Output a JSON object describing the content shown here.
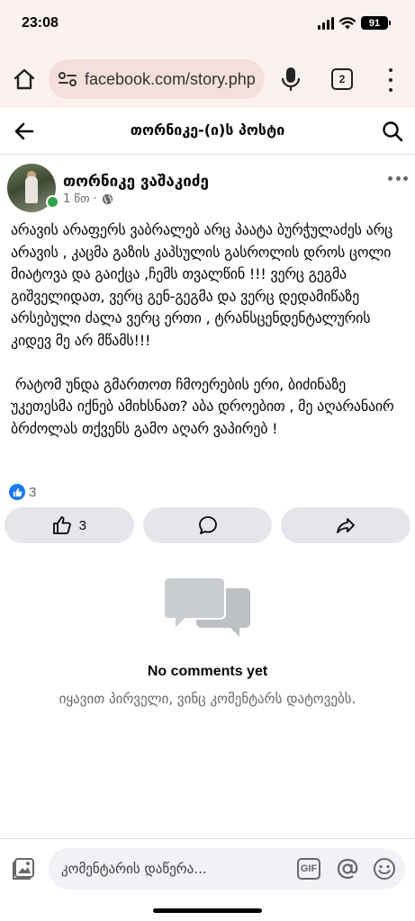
{
  "status_bar": {
    "time": "23:08",
    "battery": "91"
  },
  "browser": {
    "url": "facebook.com/story.php",
    "tab_count": "2"
  },
  "header": {
    "title": "თორნიკე-(ი)ს პოსტი"
  },
  "post": {
    "author": "თორნიკე ვაშაკიძე",
    "time": "1 წთ ·",
    "text": "არავის არაფერს ვაბრალებ არც პაატა ბურჭულაძეს არც არავის , კაცმა გაზის კაპსულის გასროლის დროს ცოლი მიატოვა და გაიქცა ,ჩემს თვალწინ !!! ვერც გეგმა გიშველიდათ, ვერც გენ-გეგმა და ვერც დედამიწაზე არსებული ძალა ვერც ერთი , ტრანსცენდენტალურის კიდევ მე არ მწამს!!!\n\n რატომ უნდა გმართოთ ჩმოერების ერი, ბიძინაზე უკეთესმა იქნებ ამიხსნათ? აბა დროებით , მე აღარანაირ ბრძოლას თქვენს გამო აღარ ვაპირებ !",
    "reaction_count": "3",
    "like_count": "3"
  },
  "comments": {
    "empty_title": "No comments yet",
    "empty_subtitle": "იყავით პირველი, ვინც კომენტარს დატოვებს."
  },
  "composer": {
    "placeholder": "კომენტარის დაწერა...",
    "gif_label": "GIF"
  },
  "colors": {
    "accent": "#1877f2",
    "online": "#31a24c",
    "browser_bg": "#fcf1ef"
  }
}
